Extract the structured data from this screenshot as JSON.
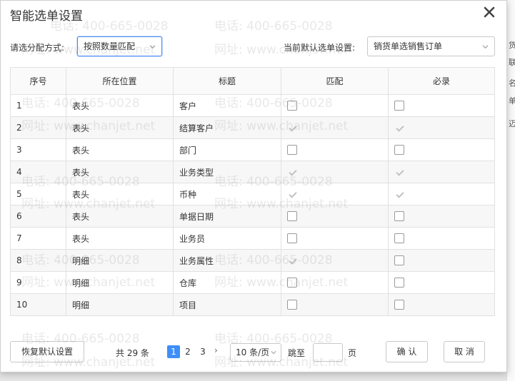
{
  "dialog": {
    "title": "智能选单设置"
  },
  "settings": {
    "method_label": "请选分配方式:",
    "method_value": "按照数量匹配",
    "default_label": "当前默认选单设置:",
    "default_value": "销货单选销售订单"
  },
  "table": {
    "headers": [
      "序号",
      "所在位置",
      "标题",
      "匹配",
      "必录"
    ],
    "rows": [
      {
        "no": "1",
        "location": "表头",
        "title": "客户",
        "match": false,
        "required": false
      },
      {
        "no": "2",
        "location": "表头",
        "title": "结算客户",
        "match": true,
        "required": true
      },
      {
        "no": "3",
        "location": "表头",
        "title": "部门",
        "match": false,
        "required": false
      },
      {
        "no": "4",
        "location": "表头",
        "title": "业务类型",
        "match": true,
        "required": true
      },
      {
        "no": "5",
        "location": "表头",
        "title": "币种",
        "match": true,
        "required": true
      },
      {
        "no": "6",
        "location": "表头",
        "title": "单据日期",
        "match": false,
        "required": false
      },
      {
        "no": "7",
        "location": "表头",
        "title": "业务员",
        "match": false,
        "required": false
      },
      {
        "no": "8",
        "location": "明细",
        "title": "业务属性",
        "match": true,
        "required": false
      },
      {
        "no": "9",
        "location": "明细",
        "title": "仓库",
        "match": false,
        "required": false
      },
      {
        "no": "10",
        "location": "明细",
        "title": "项目",
        "match": false,
        "required": false
      }
    ]
  },
  "footer": {
    "reset_label": "恢复默认设置",
    "total": "共 29 条",
    "pages": [
      "1",
      "2",
      "3"
    ],
    "next": "›",
    "page_size": "10 条/页",
    "jump_label": "跳至",
    "jump_value": "",
    "page_unit": "页",
    "confirm_label": "确 认",
    "cancel_label": "取 消"
  },
  "watermark": {
    "phone": "电话: 400-665-0028",
    "site": "网址: www.chanjet.net"
  },
  "background": {
    "fragments": [
      "货",
      "联",
      "名",
      "单",
      "迈"
    ]
  },
  "colors": {
    "accent": "#3e8ef7",
    "focus_border": "#4b8cf0"
  }
}
